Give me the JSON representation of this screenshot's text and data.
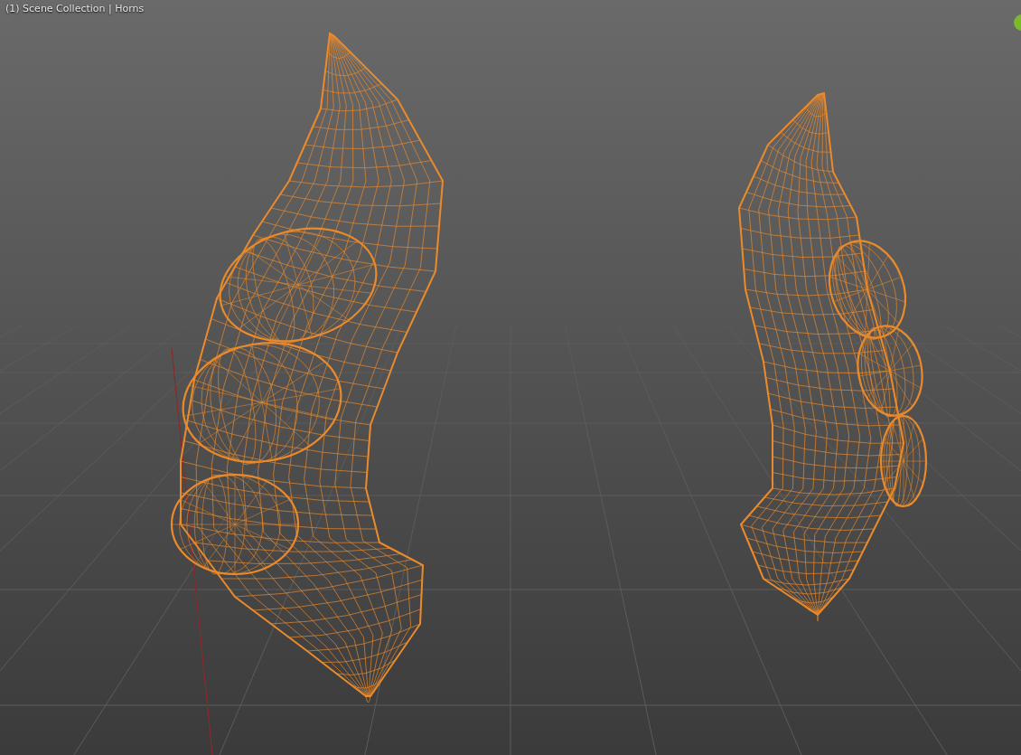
{
  "viewport": {
    "header_text": "(1) Scene Collection | Horns"
  }
}
